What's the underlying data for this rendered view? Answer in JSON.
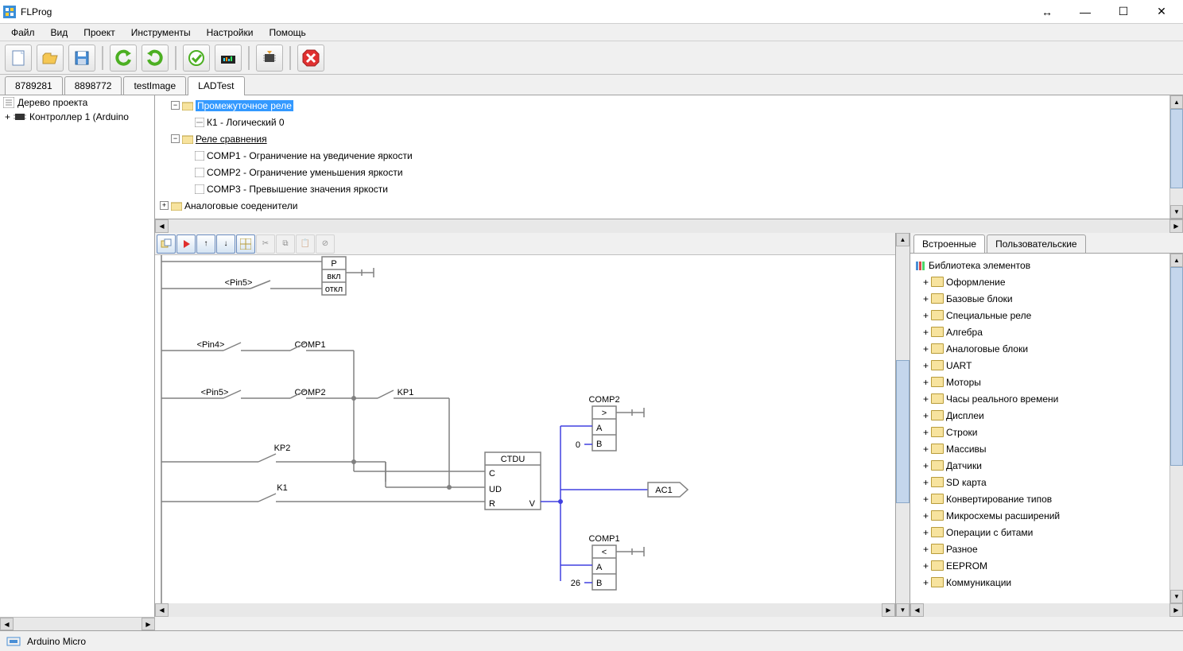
{
  "app": {
    "title": "FLProg"
  },
  "menu": {
    "file": "Файл",
    "view": "Вид",
    "project": "Проект",
    "tools": "Инструменты",
    "settings": "Настройки",
    "help": "Помощь"
  },
  "tabs": [
    {
      "label": "8789281"
    },
    {
      "label": "8898772"
    },
    {
      "label": "testImage"
    },
    {
      "label": "LADTest",
      "active": true
    }
  ],
  "projectTree": {
    "root": "Дерево проекта",
    "controller": "Контроллер 1 (Arduino"
  },
  "centerTree": {
    "n1": "Промежуточное реле",
    "n1a": "К1 - Логический 0",
    "n2": "Реле сравнения",
    "n2a": "COMP1 - Ограничение на уведичение яркости",
    "n2b": "COMP2 - Ограничение уменьшения яркости",
    "n2c": "COMP3 - Превышение значения яркости",
    "n3": "Аналоговые соеденители"
  },
  "diagram": {
    "pin5a": "<Pin5>",
    "pin4": "<Pin4>",
    "pin5b": "<Pin5>",
    "comp1": "COMP1",
    "comp2": "COMP2",
    "kp1": "KP1",
    "kp2": "KP2",
    "k1": "K1",
    "ctdu": "CTDU",
    "c": "C",
    "ud": "UD",
    "r": "R",
    "v": "V",
    "ac1": "AC1",
    "compblk2": "COMP2",
    "gt": ">",
    "a": "A",
    "b": "B",
    "zero": "0",
    "compblk1": "COMP1",
    "lt": "<",
    "twentysix": "26",
    "p": "P",
    "on": "вкл",
    "off": "откл"
  },
  "rightTabs": {
    "builtin": "Встроенные",
    "user": "Пользовательские"
  },
  "library": {
    "root": "Библиотека элементов",
    "items": [
      "Оформление",
      "Базовые блоки",
      "Специальные реле",
      "Алгебра",
      "Аналоговые блоки",
      "UART",
      "Моторы",
      "Часы реального времени",
      "Дисплеи",
      "Строки",
      "Массивы",
      "Датчики",
      "SD карта",
      "Конвертирование типов",
      "Микросхемы расширений",
      "Операции с битами",
      "Разное",
      "EEPROM",
      "Коммуникации"
    ]
  },
  "status": {
    "board": "Arduino Micro"
  }
}
